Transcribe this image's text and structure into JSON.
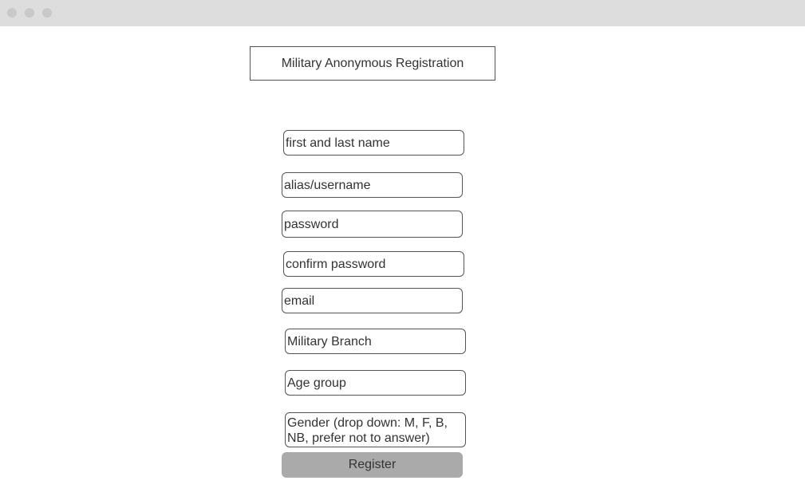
{
  "page": {
    "title": "Military Anonymous Registration"
  },
  "form": {
    "fields": [
      {
        "text": "first and last name"
      },
      {
        "text": "alias/username"
      },
      {
        "text": "password"
      },
      {
        "text": "confirm password"
      },
      {
        "text": "email"
      },
      {
        "text": "Military Branch"
      },
      {
        "text": "Age group"
      },
      {
        "text": "Gender (drop down: M, F, B, NB, prefer not to answer)"
      }
    ],
    "register_label": "Register"
  },
  "colors": {
    "titlebar": "#dddddd",
    "border": "#555555",
    "button": "#aaaaaa",
    "text": "#333333"
  }
}
